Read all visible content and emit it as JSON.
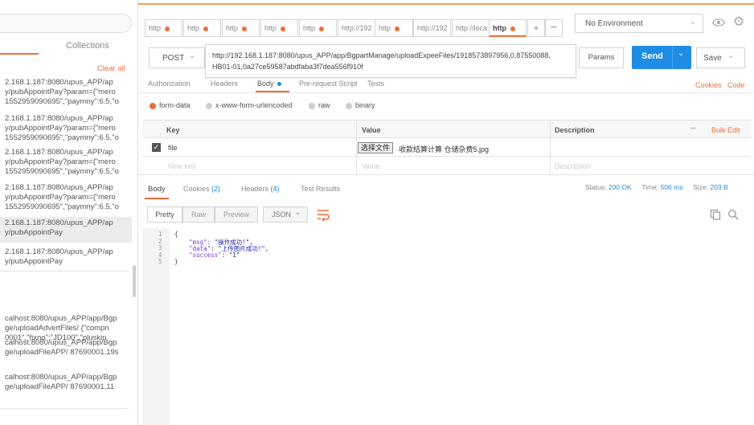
{
  "sidebar": {
    "collections_label": "Collections",
    "clear_all": "Clear all",
    "history": [
      {
        "lines": [
          "2.168.1.187:8080/upus_APP/ap",
          "y/pubAppointPay?param={\"mero",
          "1552959090695\",\"paymny\":6.5,\"o"
        ]
      },
      {
        "lines": [
          "2.168.1.187:8080/upus_APP/ap",
          "y/pubAppointPay?param={\"mero",
          "1552959090695\",\"paymny\":6.5,\"o"
        ]
      },
      {
        "lines": [
          "2.168.1.187:8080/upus_APP/ap",
          "y/pubAppointPay?param={\"mero",
          "1552959090695\",\"paymny\":6.5,\"o"
        ]
      },
      {
        "lines": [
          "2.168.1.187:8080/upus_APP/ap",
          "y/pubAppointPay?param={\"mero",
          "1552959090695\",\"paymny\":6.5,\"o"
        ]
      },
      {
        "lines": [
          "2.168.1.187:8080/upus_APP/ap",
          "y/pubAppointPay"
        ]
      },
      {
        "lines": [
          "2.168.1.187:8080/upus_APP/ap",
          "y/pubAppointPay"
        ]
      },
      {
        "lines": [
          "calhost:8080/upus_APP/app/Bgp",
          "ge/uploadAdvertFiles/ {\"compn",
          "0001\",\"fixno\":\"JD100\",\"pluskin"
        ]
      },
      {
        "lines": [
          "calhost:8080/upus_APP/app/Bgp",
          "ge/uploadFileAPP/ 87690001,19s"
        ]
      },
      {
        "lines": [
          "calhost:8080/upus_APP/app/Bgp",
          "ge/uploadFileAPP/ 87690001,11"
        ]
      }
    ]
  },
  "tabs": [
    "http",
    "http",
    "http",
    "http",
    "http",
    "http",
    "http://192",
    "http",
    "http://192",
    "http://loca",
    "http"
  ],
  "tab_add": "+",
  "tab_more": "•••",
  "environment": "No Environment",
  "method": "POST",
  "url_line1": "http://192.168.1.187:8080/upus_APP/app/BgpartManage/uploadExpeeFiles/1918573897956,0,87550088,",
  "url_line2": "HB01-01,0a27ce59587abdfaba3f7dea556f910f",
  "params_label": "Params",
  "send_label": "Send",
  "save_label": "Save",
  "req_tabs": {
    "authorization": "Authorization",
    "headers": "Headers",
    "body": "Body",
    "prerequest": "Pre-request Script",
    "tests": "Tests"
  },
  "cookies_label": "Cookies",
  "code_label": "Code",
  "body_modes": {
    "form_data": "form-data",
    "urlencoded": "x-www-form-urlencoded",
    "raw": "raw",
    "binary": "binary"
  },
  "table": {
    "key_header": "Key",
    "value_header": "Value",
    "desc_header": "Description",
    "dots": "•••",
    "bulk_edit": "Bulk Edit",
    "row_key": "file",
    "choose_file": "选择文件",
    "file_name": "收款结算计算 仓储杂费5.jpg",
    "new_key": "New key",
    "value_placeholder": "Value",
    "desc_placeholder": "Description"
  },
  "resp_tabs": {
    "body": "Body",
    "cookies": "Cookies",
    "cookies_count": "(2)",
    "headers": "Headers",
    "headers_count": "(4)",
    "test_results": "Test Results"
  },
  "status": {
    "status_label": "Status:",
    "status_value": "200 OK",
    "time_label": "Time:",
    "time_value": "506 ms",
    "size_label": "Size:",
    "size_value": "203 B"
  },
  "view_modes": {
    "pretty": "Pretty",
    "raw": "Raw",
    "preview": "Preview",
    "format": "JSON"
  },
  "code_lines": [
    {
      "num": "1",
      "text": "{"
    },
    {
      "num": "2",
      "key": "\"msg\"",
      "val": "\"操作成功!\","
    },
    {
      "num": "3",
      "key": "\"data\"",
      "val": "\"上传图片成功!\","
    },
    {
      "num": "4",
      "key": "\"success\"",
      "val": "\"1\""
    },
    {
      "num": "5",
      "text": "}"
    }
  ],
  "colors": {
    "accent": "#f26b3a",
    "send": "#1f8ce6",
    "link": "#1f8ce6",
    "status_ok": "#1f8ce6"
  }
}
